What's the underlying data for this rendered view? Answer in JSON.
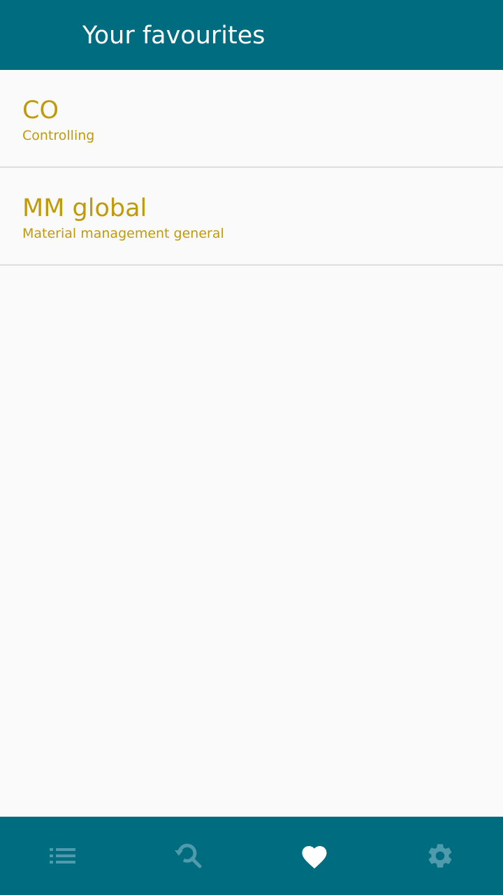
{
  "toolbar": {
    "title": "Your favourites"
  },
  "favourites": [
    {
      "title": "CO",
      "subtitle": "Controlling"
    },
    {
      "title": "MM global",
      "subtitle": "Material management general"
    }
  ],
  "bottom_nav": [
    {
      "icon": "list-icon",
      "active": false
    },
    {
      "icon": "search-history-icon",
      "active": false
    },
    {
      "icon": "heart-icon",
      "active": true
    },
    {
      "icon": "gear-icon",
      "active": false
    }
  ],
  "colors": {
    "primary": "#006c80",
    "accent_text": "#bf9a0a",
    "icon_inactive": "#4f9aab",
    "icon_active": "#ffffff",
    "background": "#fafafa",
    "divider": "#dedede"
  }
}
